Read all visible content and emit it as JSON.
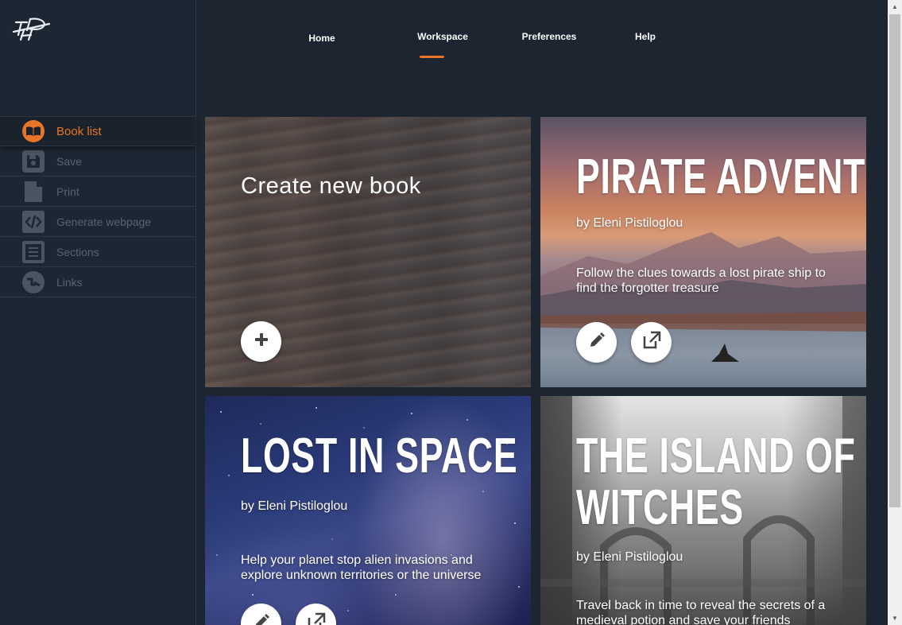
{
  "nav": {
    "home": "Home",
    "workspace": "Workspace",
    "preferences": "Preferences",
    "help": "Help",
    "active": "Workspace"
  },
  "sidebar": {
    "items": [
      {
        "label": "Book list",
        "icon": "open-book-icon",
        "active": true
      },
      {
        "label": "Save",
        "icon": "floppy-disk-icon",
        "active": false
      },
      {
        "label": "Print",
        "icon": "document-icon",
        "active": false
      },
      {
        "label": "Generate webpage",
        "icon": "code-icon",
        "active": false
      },
      {
        "label": "Sections",
        "icon": "list-icon",
        "active": false
      },
      {
        "label": "Links",
        "icon": "link-icon",
        "active": false
      }
    ]
  },
  "cards": {
    "create": {
      "title": "Create new book",
      "icon": "plus-icon"
    },
    "book1": {
      "title": "PIRATE ADVENTURE",
      "author": "by Eleni Pistiloglou",
      "description": "Follow the clues towards a lost pirate ship to find the forgotter treasure"
    },
    "book2": {
      "title": "LOST IN SPACE",
      "author": "by Eleni Pistiloglou",
      "description": "Help your planet stop alien invasions and explore unknown territories or the universe"
    },
    "book3": {
      "title_line1": "THE ISLAND OF THE",
      "title_line2": "WITCHES",
      "author": "by Eleni Pistiloglou",
      "description": "Travel back in time to reveal the secrets of a medieval potion and save your friends"
    }
  },
  "colors": {
    "accent": "#e87528",
    "sidebar_bg": "#1d2733",
    "page_bg": "#1c2530",
    "inactive_text": "#586370"
  }
}
